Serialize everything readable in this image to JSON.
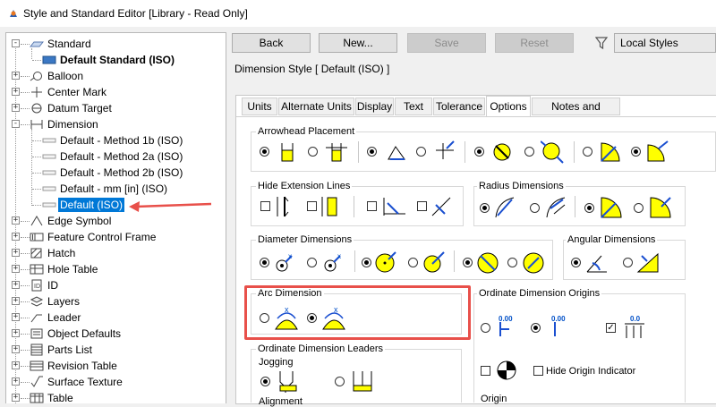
{
  "window": {
    "title": "Style and Standard Editor [Library - Read Only]"
  },
  "tree": {
    "items": [
      {
        "label": "Standard",
        "icon": "standard-icon"
      },
      {
        "label": "Default Standard (ISO)",
        "icon": "active-standard-icon"
      },
      {
        "label": "Balloon",
        "icon": "balloon-icon"
      },
      {
        "label": "Center Mark",
        "icon": "center-mark-icon"
      },
      {
        "label": "Datum Target",
        "icon": "datum-target-icon"
      },
      {
        "label": "Dimension",
        "icon": "dimension-icon"
      },
      {
        "label": "Default - Method 1b (ISO)",
        "icon": "style-icon"
      },
      {
        "label": "Default - Method 2a (ISO)",
        "icon": "style-icon"
      },
      {
        "label": "Default - Method 2b (ISO)",
        "icon": "style-icon"
      },
      {
        "label": "Default - mm [in] (ISO)",
        "icon": "style-icon"
      },
      {
        "label": "Default (ISO)",
        "icon": "style-icon"
      },
      {
        "label": "Edge Symbol",
        "icon": "edge-symbol-icon"
      },
      {
        "label": "Feature Control Frame",
        "icon": "feature-control-frame-icon"
      },
      {
        "label": "Hatch",
        "icon": "hatch-icon"
      },
      {
        "label": "Hole Table",
        "icon": "hole-table-icon"
      },
      {
        "label": "ID",
        "icon": "id-icon"
      },
      {
        "label": "Layers",
        "icon": "layers-icon"
      },
      {
        "label": "Leader",
        "icon": "leader-icon"
      },
      {
        "label": "Object Defaults",
        "icon": "object-defaults-icon"
      },
      {
        "label": "Parts List",
        "icon": "parts-list-icon"
      },
      {
        "label": "Revision Table",
        "icon": "revision-table-icon"
      },
      {
        "label": "Surface Texture",
        "icon": "surface-texture-icon"
      },
      {
        "label": "Table",
        "icon": "table-icon"
      }
    ]
  },
  "toolbar": {
    "back": "Back",
    "new": "New...",
    "save": "Save",
    "reset": "Reset",
    "filter_value": "Local Styles"
  },
  "main": {
    "header": "Dimension Style [ Default (ISO) ]",
    "tabs": [
      "Units",
      "Alternate Units",
      "Display",
      "Text",
      "Tolerance",
      "Options",
      "Notes and Leaders"
    ],
    "active_tab": "Options"
  },
  "groups": {
    "arrowhead": "Arrowhead Placement",
    "hide_ext": "Hide Extension Lines",
    "radius": "Radius Dimensions",
    "diameter": "Diameter Dimensions",
    "angular": "Angular Dimensions",
    "arc": "Arc Dimension",
    "ordinate_origins": "Ordinate Dimension Origins",
    "ordinate_leaders": "Ordinate Dimension Leaders",
    "jogging": "Jogging",
    "alignment": "Alignment",
    "hide_origin": "Hide Origin Indicator",
    "origin": "Origin",
    "ord_value_a": "0.00",
    "ord_value_b": "0.00",
    "ord_value_c": "0.0",
    "arc_symbol": "x"
  },
  "colors": {
    "accent": "#0078d7",
    "highlight": "#e8504a",
    "symbol_fill": "#ffff00"
  }
}
